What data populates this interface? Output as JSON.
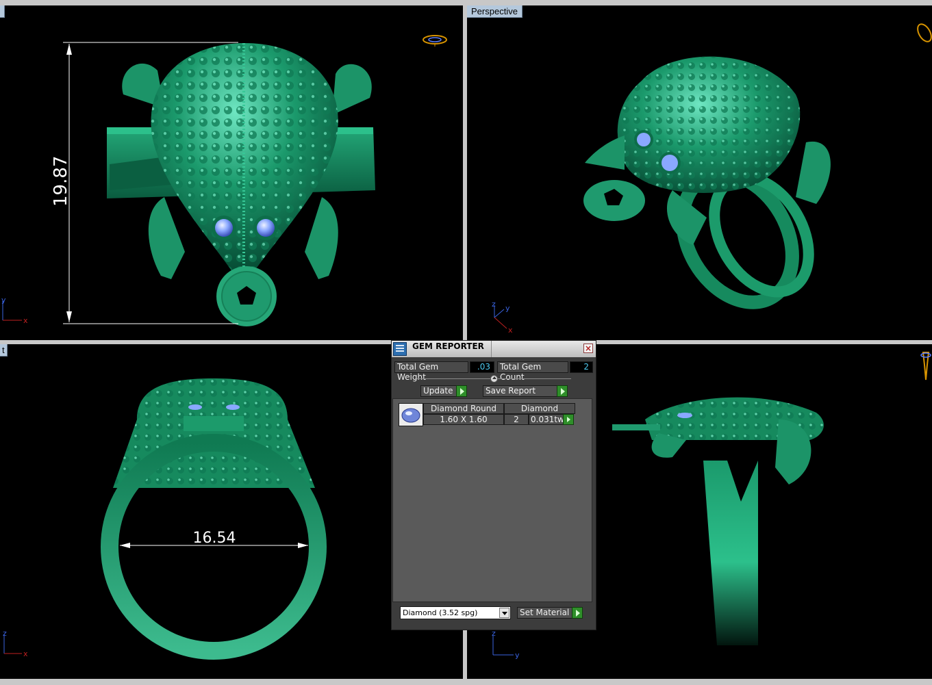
{
  "viewports": {
    "top": {
      "label": "",
      "dimension": "19.87",
      "axis": {
        "v": "y",
        "h": "x"
      }
    },
    "perspective": {
      "label": "Perspective",
      "axis": {
        "v": "z",
        "d": "y",
        "h": "x"
      }
    },
    "front": {
      "label": "t",
      "dimension": "16.54",
      "axis": {
        "v": "z",
        "h": "x"
      }
    },
    "right": {
      "label": "",
      "axis": {
        "v": "z",
        "h": "y"
      }
    }
  },
  "gem_reporter": {
    "title": "GEM REPORTER",
    "close_icon": "close-icon",
    "total_gem_weight_label": "Total Gem Weight",
    "total_gem_weight_value": ".03",
    "total_gem_count_label": "Total Gem Count",
    "total_gem_count_value": "2",
    "update_label": "Update",
    "save_report_label": "Save Report",
    "gems": [
      {
        "shape": "Diamond Round",
        "size": "1.60 X 1.60",
        "material": "Diamond",
        "count": "2",
        "weight": "0.031tw"
      }
    ],
    "material_select": "Diamond    (3.52 spg)",
    "set_material_label": "Set Material"
  },
  "colors": {
    "viewport_bg": "#000000",
    "metal_green": "#1f9a6e",
    "gem_blue": "#8aa8ff",
    "panel_bg": "#3c3c3c",
    "accent_green": "#2f8f2a"
  }
}
